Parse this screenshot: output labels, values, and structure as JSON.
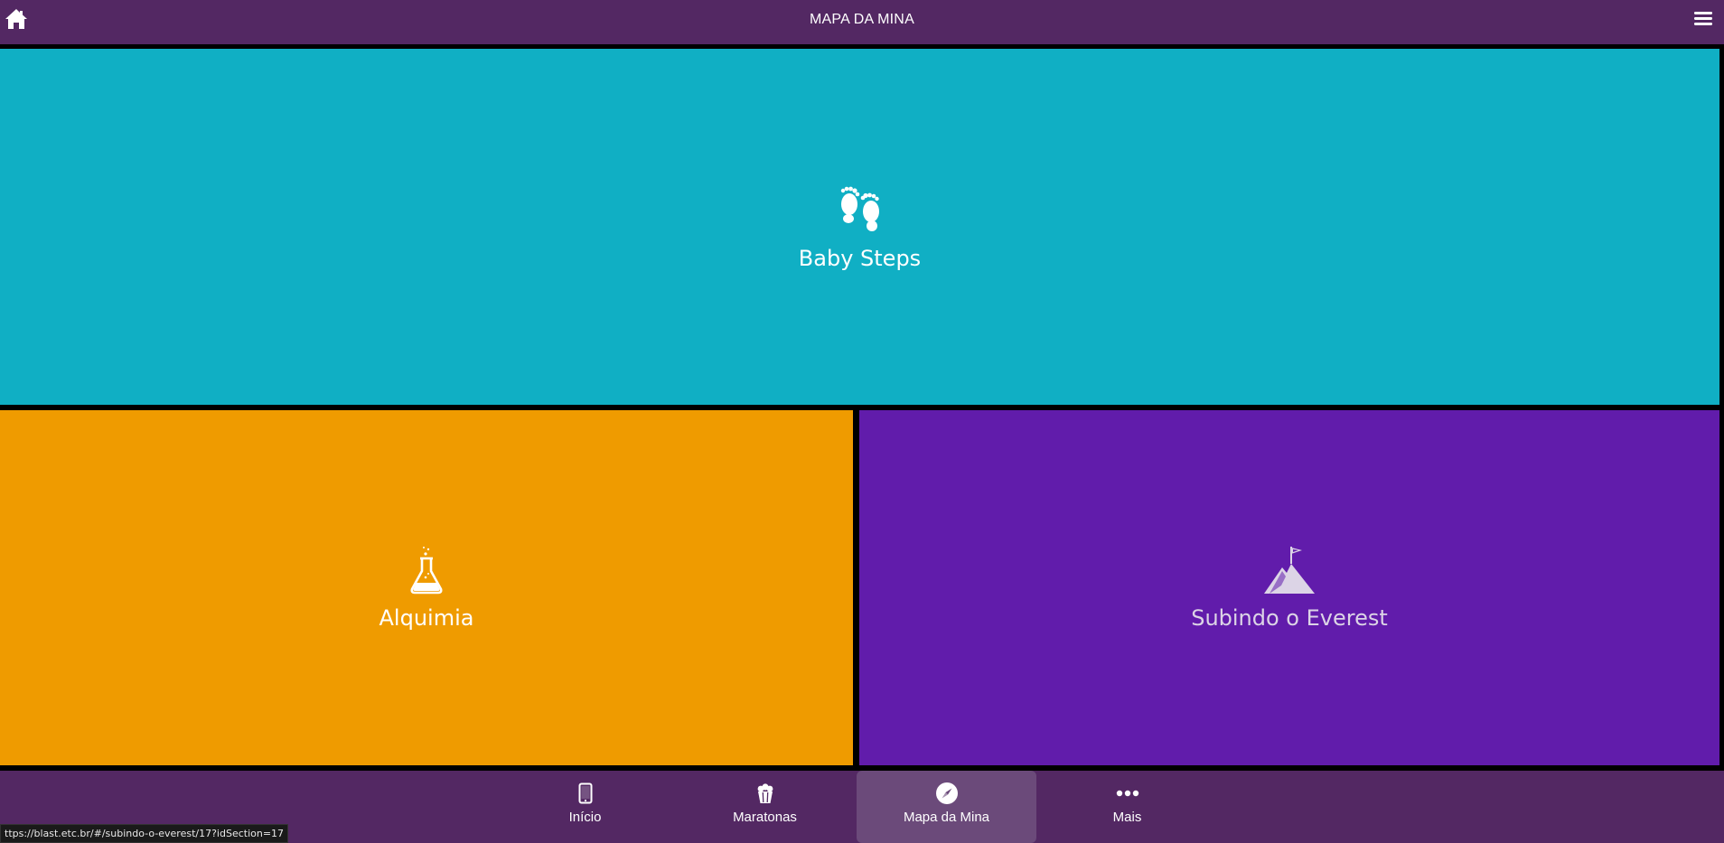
{
  "header": {
    "title": "MAPA DA MINA"
  },
  "tiles": [
    {
      "label": "Baby Steps",
      "icon": "footprints-icon",
      "color": "#10AFC4"
    },
    {
      "label": "Alquimia",
      "icon": "flask-icon",
      "color": "#EF9B00"
    },
    {
      "label": "Subindo o Everest",
      "icon": "mountain-flag-icon",
      "color": "#611CAB"
    }
  ],
  "tabs": [
    {
      "label": "Início",
      "icon": "phone-icon",
      "active": false
    },
    {
      "label": "Maratonas",
      "icon": "popcorn-icon",
      "active": false
    },
    {
      "label": "Mapa da Mina",
      "icon": "compass-icon",
      "active": true
    },
    {
      "label": "Mais",
      "icon": "more-dots-icon",
      "active": false
    }
  ],
  "status_url": "ttps://blast.etc.br/#/subindo-o-everest/17?idSection=17",
  "colors": {
    "bar": "#532863",
    "active_tab": "#6B4A7A"
  }
}
